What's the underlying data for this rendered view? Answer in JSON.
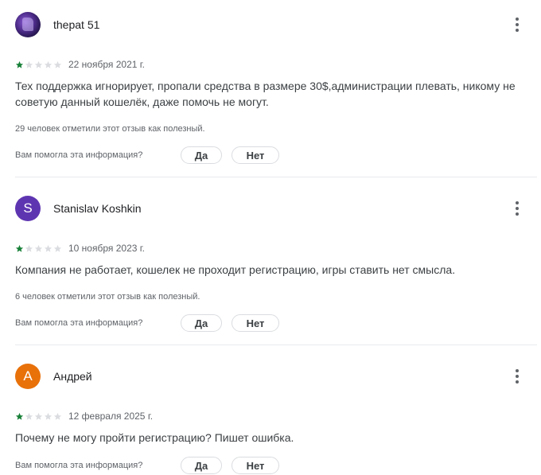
{
  "colors": {
    "star_filled": "#188038",
    "star_empty": "#dadce0",
    "avatar_s": "#5e35b1",
    "avatar_a": "#e8710a"
  },
  "icons": {
    "more": "more-vert-icon",
    "star": "star-icon"
  },
  "reviews": [
    {
      "author": "thepat 51",
      "avatar_letter": "",
      "rating": 1,
      "rating_max": 5,
      "date": "22 ноября 2021 г.",
      "text": "Тех поддержка игнорирует, пропали средства в размере 30$,администрации плевать, никому не советую данный кошелёк, даже помочь не могут.",
      "helpful_count": "29 человек отметили этот отзыв как полезный.",
      "question": "Вам помогла эта информация?",
      "yes": "Да",
      "no": "Нет"
    },
    {
      "author": "Stanislav Koshkin",
      "avatar_letter": "S",
      "rating": 1,
      "rating_max": 5,
      "date": "10 ноября 2023 г.",
      "text": "Компания не работает, кошелек не проходит регистрацию, игры ставить нет смысла.",
      "helpful_count": "6 человек отметили этот отзыв как полезный.",
      "question": "Вам помогла эта информация?",
      "yes": "Да",
      "no": "Нет"
    },
    {
      "author": "Андрей",
      "avatar_letter": "А",
      "rating": 1,
      "rating_max": 5,
      "date": "12 февраля 2025 г.",
      "text": "Почему не могу пройти регистрацию? Пишет ошибка.",
      "question": "Вам помогла эта информация?",
      "yes": "Да",
      "no": "Нет"
    }
  ]
}
